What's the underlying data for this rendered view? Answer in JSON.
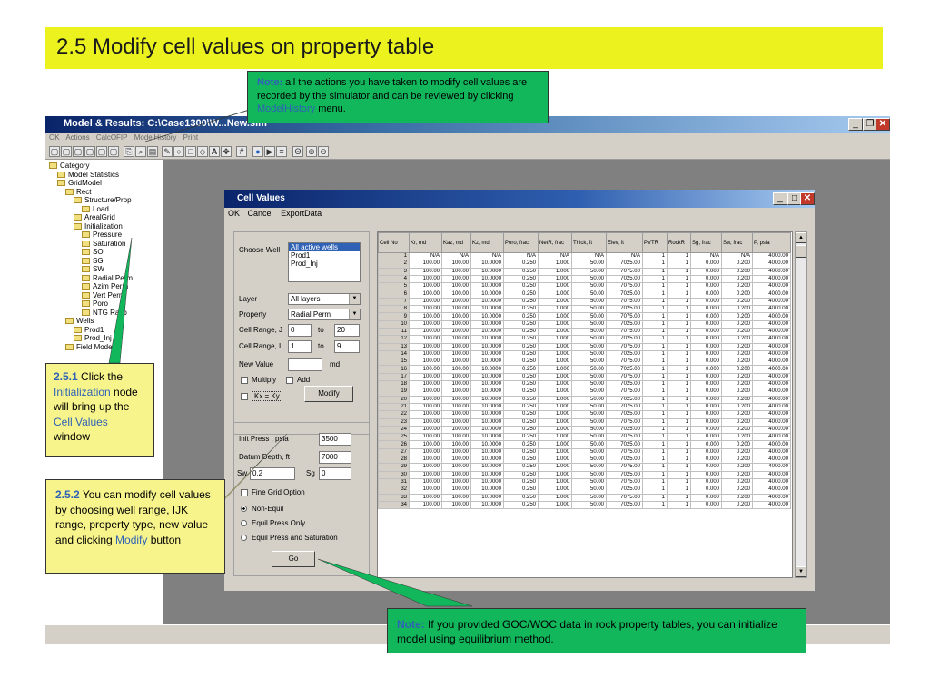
{
  "slide": {
    "title": "2.5 Modify cell values on property table"
  },
  "app": {
    "title": "Model & Results:  C:\\Case1300\\W...New.sim",
    "menu": [
      "OK",
      "Actions",
      "CalcOFIP",
      "ModelHistory",
      "Print"
    ],
    "tree": [
      {
        "label": "Category",
        "level": 0
      },
      {
        "label": "Model Statistics",
        "level": 1
      },
      {
        "label": "GridModel",
        "level": 1
      },
      {
        "label": "Rect",
        "level": 2
      },
      {
        "label": "Structure/Prop",
        "level": 3
      },
      {
        "label": "Load",
        "level": 4
      },
      {
        "label": "ArealGrid",
        "level": 3
      },
      {
        "label": "Initialization",
        "level": 3
      },
      {
        "label": "Pressure",
        "level": 4
      },
      {
        "label": "Saturation",
        "level": 4
      },
      {
        "label": "SO",
        "level": 4
      },
      {
        "label": "SG",
        "level": 4
      },
      {
        "label": "SW",
        "level": 4
      },
      {
        "label": "Radial Perm",
        "level": 4
      },
      {
        "label": "Azim Perm",
        "level": 4
      },
      {
        "label": "Vert Perm",
        "level": 4
      },
      {
        "label": "Poro",
        "level": 4
      },
      {
        "label": "NTG Ratio",
        "level": 4
      },
      {
        "label": "Wells",
        "level": 2
      },
      {
        "label": "Prod1",
        "level": 3
      },
      {
        "label": "Prod_Inj",
        "level": 3
      },
      {
        "label": "Field Model",
        "level": 2
      }
    ]
  },
  "cell_values": {
    "title": "Cell Values",
    "menu": [
      "OK",
      "Cancel",
      "ExportData"
    ],
    "choose_well_label": "Choose Well",
    "wells": [
      "All active wells",
      "Prod1",
      "Prod_Inj"
    ],
    "layer_label": "Layer",
    "layer_value": "All layers",
    "property_label": "Property",
    "property_value": "Radial Perm",
    "range_j_label": "Cell Range, J",
    "range_j_from": "0",
    "range_j_to": "20",
    "range_i_label": "Cell Range, I",
    "range_i_from": "1",
    "range_i_to": "9",
    "to_label": "to",
    "new_value_label": "New Value",
    "new_value_unit": "md",
    "multiply_label": "Multiply",
    "add_label": "Add",
    "kx_ky_label": "Kx = Ky",
    "modify_label": "Modify",
    "init_press_label": "Init Press , psia",
    "init_press_value": "3500",
    "datum_depth_label": "Datum Depth, ft",
    "datum_depth_value": "7000",
    "sw_label": "Sw",
    "sw_value": "0.2",
    "sg_label": "Sg",
    "sg_value": "0",
    "fine_grid_label": "Fine Grid Option",
    "options": [
      "Non-Equil",
      "Equil Press Only",
      "Equil Press and Saturation"
    ],
    "go_label": "Go",
    "grid": {
      "headers": [
        "Cell No",
        "Kr, md",
        "Kaz, md",
        "Kz, md",
        "Poro, frac",
        "NetR, frac",
        "Thick, ft",
        "Elev, ft",
        "PVTR",
        "RockR",
        "Sg, frac",
        "Sw, frac",
        "P, psia"
      ],
      "first_row": [
        "1",
        "N/A",
        "N/A",
        "N/A",
        "N/A",
        "N/A",
        "N/A",
        "N/A",
        "1",
        "1",
        "N/A",
        "N/A",
        "4000.00"
      ],
      "row_template": [
        "100.00",
        "100.00",
        "10.0000",
        "0.250",
        "1.000",
        "50.00",
        "",
        "1",
        "1",
        "0.000",
        "0.200",
        "4000.00"
      ],
      "elev_even": "7025.00",
      "elev_odd": "7075.00",
      "last_row": 34
    }
  },
  "callouts": {
    "top_note": "Note:",
    "top_text_1": " all the actions you have taken to modify cell values are recorded by the simulator and can be reviewed by clicking ",
    "top_link": "ModelHistory",
    "top_text_2": " menu.",
    "c1_num": "2.5.1",
    "c1_text_1": " Click the ",
    "c1_link_1": "Initialization",
    "c1_text_2": " node will bring up the ",
    "c1_link_2": "Cell Values",
    "c1_text_3": " window",
    "c2_num": "2.5.2",
    "c2_text_1": "  You can modify cell values by choosing well range, IJK range, property type, new value and clicking ",
    "c2_link": "Modify",
    "c2_text_2": " button",
    "bottom_note": "Note:",
    "bottom_text": " If you provided GOC/WOC data in rock property tables, you can initialize model using equilibrium method."
  },
  "colors": {
    "callout": "#12b75c",
    "title_band": "#ebf21d",
    "link": "#2f62b5",
    "app_bg": "#808080"
  }
}
